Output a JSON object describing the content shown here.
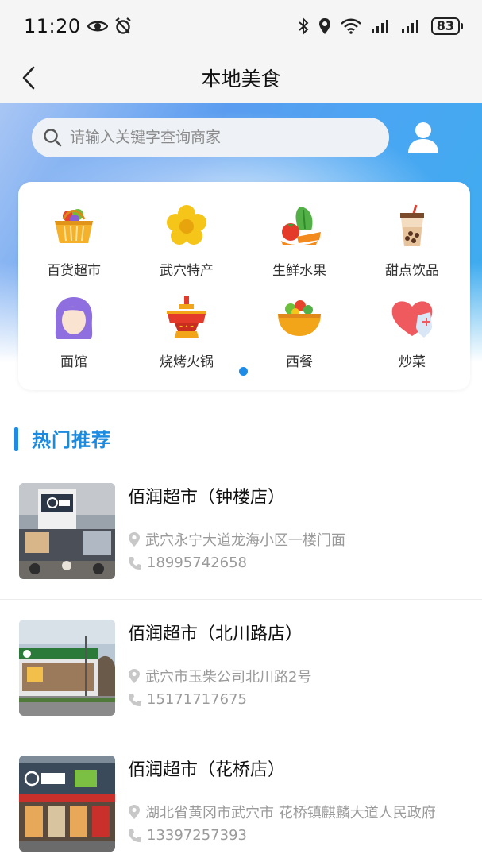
{
  "status_bar": {
    "time": "11:20",
    "battery": "83"
  },
  "nav": {
    "title": "本地美食"
  },
  "search": {
    "placeholder": "请输入关键字查询商家"
  },
  "categories": [
    {
      "label": "百货超市",
      "icon": "basket-icon"
    },
    {
      "label": "武穴特产",
      "icon": "flower-icon"
    },
    {
      "label": "生鲜水果",
      "icon": "vegetables-icon"
    },
    {
      "label": "甜点饮品",
      "icon": "bubble-tea-icon"
    },
    {
      "label": "面馆",
      "icon": "face-icon"
    },
    {
      "label": "烧烤火锅",
      "icon": "hotpot-icon"
    },
    {
      "label": "西餐",
      "icon": "salad-bowl-icon"
    },
    {
      "label": "炒菜",
      "icon": "heart-shield-icon"
    }
  ],
  "section": {
    "title": "热门推荐"
  },
  "stores": [
    {
      "name": "佰润超市（钟楼店）",
      "address": "武穴永宁大道龙海小区一楼门面",
      "phone": "18995742658"
    },
    {
      "name": "佰润超市（北川路店）",
      "address": "武穴市玉柴公司北川路2号",
      "phone": "15171717675"
    },
    {
      "name": "佰润超市（花桥店）",
      "address": "湖北省黄冈市武穴市 花桥镇麒麟大道人民政府",
      "phone": "13397257393"
    }
  ],
  "colors": {
    "accent": "#1e8ce6",
    "section_title": "#1a8be0"
  }
}
